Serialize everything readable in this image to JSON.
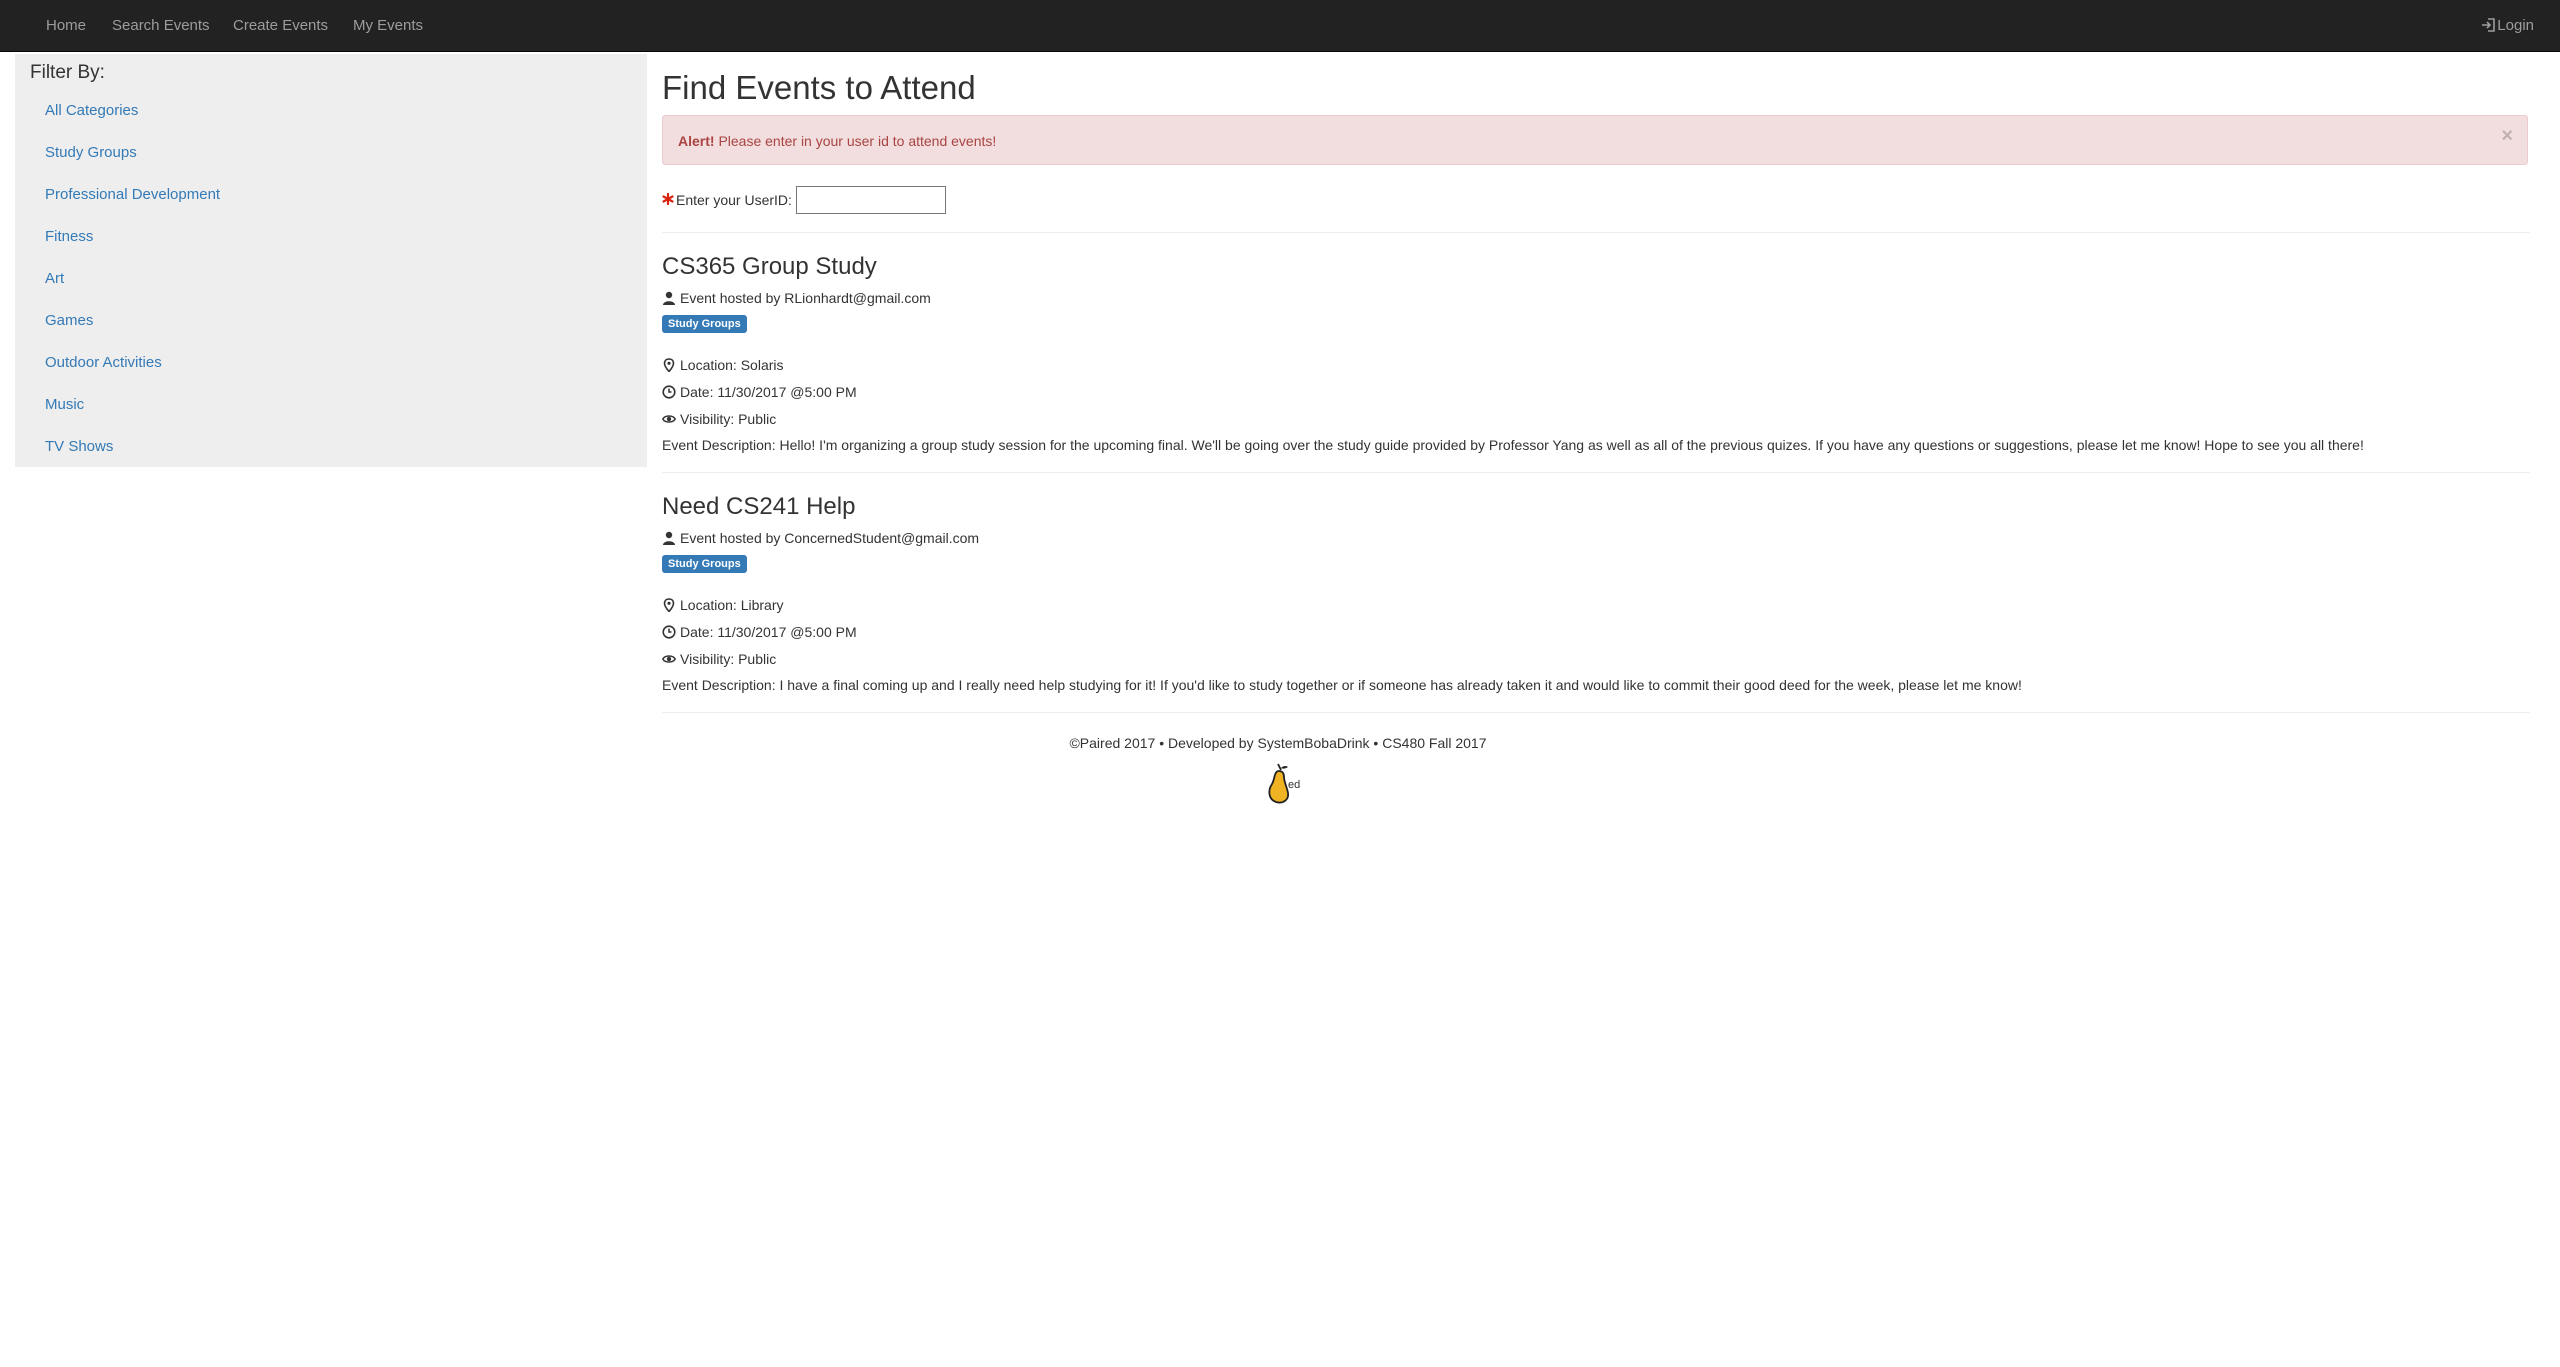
{
  "nav": {
    "items": [
      "Home",
      "Search Events",
      "Create Events",
      "My Events"
    ],
    "login_label": "Login"
  },
  "sidebar": {
    "title": "Filter By:",
    "items": [
      "All Categories",
      "Study Groups",
      "Professional Development",
      "Fitness",
      "Art",
      "Games",
      "Outdoor Activities",
      "Music",
      "TV Shows"
    ]
  },
  "main": {
    "title": "Find Events to Attend",
    "alert": {
      "strong": "Alert!",
      "text": " Please enter in your user id to attend events!",
      "close": "×"
    },
    "userid": {
      "label": "Enter your UserID:",
      "value": "",
      "placeholder": ""
    },
    "events": [
      {
        "title": "CS365 Group Study",
        "host": "Event hosted by RLionhardt@gmail.com",
        "category": "Study Groups",
        "location": "Location: Solaris",
        "date": "Date: 11/30/2017 @5:00 PM",
        "visibility": "Visibility: Public",
        "description": "Event Description: Hello! I'm organizing a group study session for the upcoming final. We'll be going over the study guide provided by Professor Yang as well as all of the previous quizes. If you have any questions or suggestions, please let me know! Hope to see you all there!"
      },
      {
        "title": "Need CS241 Help",
        "host": "Event hosted by ConcernedStudent@gmail.com",
        "category": "Study Groups",
        "location": "Location: Library",
        "date": "Date: 11/30/2017 @5:00 PM",
        "visibility": "Visibility: Public",
        "description": "Event Description: I have a final coming up and I really need help studying for it! If you'd like to study together or if someone has already taken it and would like to commit their good deed for the week, please let me know!"
      }
    ]
  },
  "footer": {
    "text": "©Paired 2017 • Developed by SystemBobaDrink • CS480 Fall 2017",
    "logo_text": "ed"
  },
  "colors": {
    "navbar": "#222222",
    "nav_text": "#9d9d9d",
    "link": "#337ab7",
    "alert_bg": "#f2dede",
    "alert_text": "#a94442",
    "badge": "#337ab7",
    "logo_pear": "#f0b323"
  }
}
